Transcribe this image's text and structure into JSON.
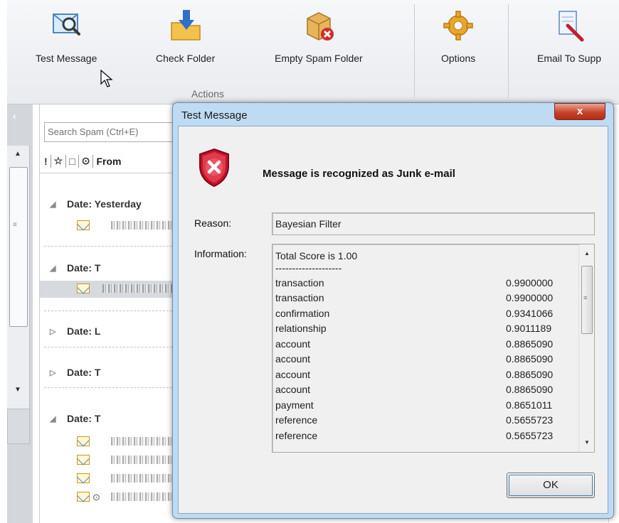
{
  "ribbon": {
    "buttons": [
      {
        "label": "Test Message"
      },
      {
        "label": "Check Folder"
      },
      {
        "label": "Empty Spam Folder"
      },
      {
        "label": "Options"
      },
      {
        "label": "Email To Supp"
      }
    ],
    "group_label": "Actions"
  },
  "list": {
    "search_placeholder": "Search Spam (Ctrl+E)",
    "column_from": "From",
    "groups": [
      {
        "label": "Date: Yesterday"
      },
      {
        "label": "Date: T"
      },
      {
        "label": "Date: L"
      },
      {
        "label": "Date: T"
      },
      {
        "label": "Date: T"
      }
    ]
  },
  "dialog": {
    "title": "Test Message",
    "close_label": "x",
    "headline": "Message is recognized as Junk e-mail",
    "reason_label": "Reason:",
    "reason_value": "Bayesian Filter",
    "information_label": "Information:",
    "total_score": "Total Score is 1.00",
    "divider": "--------------------",
    "rows": [
      {
        "word": "transaction",
        "score": "0.9900000"
      },
      {
        "word": "transaction",
        "score": "0.9900000"
      },
      {
        "word": "confirmation",
        "score": "0.9341066"
      },
      {
        "word": "relationship",
        "score": "0.9011189"
      },
      {
        "word": "account",
        "score": "0.8865090"
      },
      {
        "word": "account",
        "score": "0.8865090"
      },
      {
        "word": "account",
        "score": "0.8865090"
      },
      {
        "word": "account",
        "score": "0.8865090"
      },
      {
        "word": "payment",
        "score": "0.8651011"
      },
      {
        "word": "reference",
        "score": "0.5655723"
      },
      {
        "word": "reference",
        "score": "0.5655723"
      }
    ],
    "ok_label": "OK"
  },
  "colors": {
    "dialog_frame": "#bfdbf3",
    "close_red": "#c7432b",
    "shield_red": "#c8102e",
    "selected_row": "#d6dade"
  }
}
